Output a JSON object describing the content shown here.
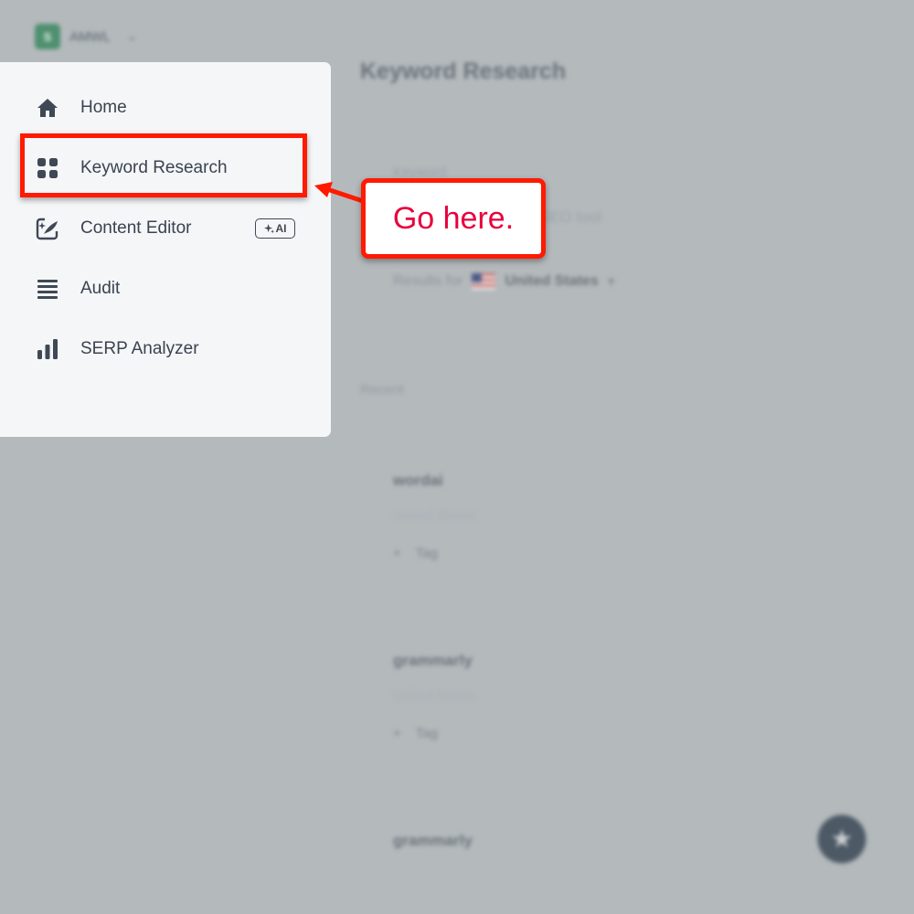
{
  "workspace": {
    "initial": "S",
    "name": "AMWL"
  },
  "page": {
    "title": "Keyword Research",
    "field_label": "Keyword",
    "field_placeholder": "SEO tool",
    "results_label": "Results for",
    "country": "United States",
    "recent_label": "Recent"
  },
  "recent": [
    {
      "term": "wordai",
      "country": "United States",
      "tag_label": "Tag"
    },
    {
      "term": "grammarly",
      "country": "United States",
      "tag_label": "Tag"
    },
    {
      "term": "grammarly"
    }
  ],
  "menu": {
    "items": [
      {
        "label": "Home",
        "icon": "home-icon"
      },
      {
        "label": "Keyword Research",
        "icon": "grid-icon"
      },
      {
        "label": "Content Editor",
        "icon": "edit-sparkle-icon",
        "badge": "AI"
      },
      {
        "label": "Audit",
        "icon": "list-icon"
      },
      {
        "label": "SERP Analyzer",
        "icon": "bar-chart-icon"
      }
    ]
  },
  "annotation": {
    "callout_text": "Go here."
  },
  "colors": {
    "annotation_red": "#ff1a00",
    "callout_text": "#e8003c",
    "menu_text": "#3a4350"
  }
}
